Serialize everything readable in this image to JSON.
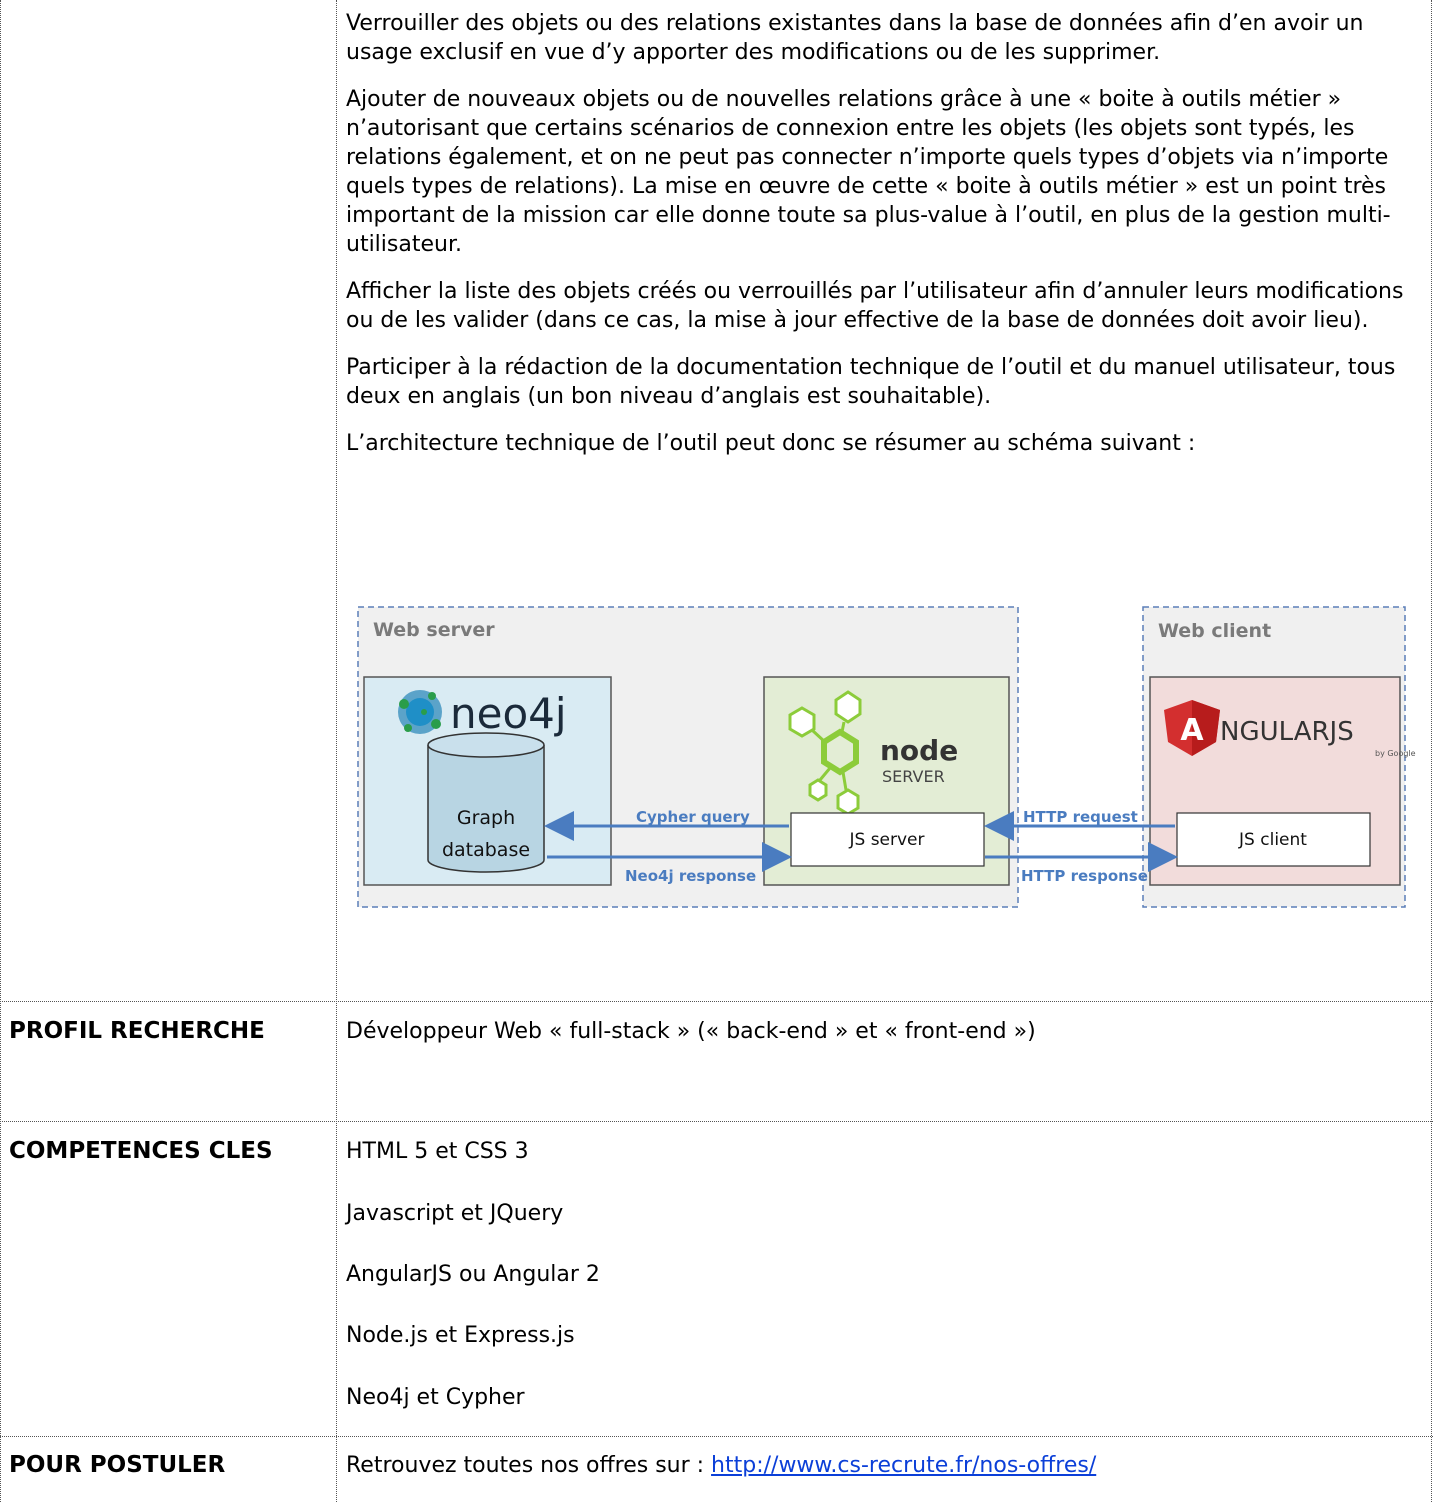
{
  "description": {
    "paragraphs": [
      "Verrouiller des objets ou des relations existantes dans la base de données afin d’en avoir un usage exclusif en vue d’y apporter des modifications ou de les supprimer.",
      "Ajouter de nouveaux objets ou de nouvelles relations grâce à une « boite à outils métier » n’autorisant que certains scénarios de connexion entre les objets (les objets sont typés, les relations également, et on ne peut pas connecter n’importe quels types d’objets via n’importe quels types de relations). La mise en œuvre de cette « boite à outils métier » est un point très important de la mission car elle donne toute sa plus-value à l’outil, en plus de la gestion multi-utilisateur.",
      "Afficher la liste des objets créés ou verrouillés par l’utilisateur afin d’annuler leurs modifications ou de les valider (dans ce cas, la mise à jour effective de la base de données doit avoir lieu).",
      "Participer à la rédaction de la documentation technique de l’outil et du manuel utilisateur, tous deux en anglais (un bon niveau d’anglais est souhaitable).",
      "L’architecture technique de l’outil peut donc se résumer au schéma suivant :"
    ]
  },
  "diagram": {
    "web_server_label": "Web server",
    "web_client_label": "Web client",
    "neo4j_logo": "neo4j",
    "graph_db_line1": "Graph",
    "graph_db_line2": "database",
    "node_logo_main": "node",
    "node_logo_sub": "SERVER",
    "angular_logo_a": "A",
    "angular_logo_rest": "NGULARJS",
    "angular_logo_by": "by Google",
    "js_server": "JS server",
    "js_client": "JS client",
    "cypher_query": "Cypher query",
    "neo4j_response": "Neo4j response",
    "http_request": "HTTP  request",
    "http_response": "HTTP  response"
  },
  "profile": {
    "label": "PROFIL RECHERCHE",
    "value": "Développeur Web « full-stack » (« back-end » et « front-end »)"
  },
  "skills": {
    "label": "COMPETENCES CLES",
    "items": [
      "HTML 5 et CSS 3",
      "Javascript et JQuery",
      "AngularJS ou Angular 2",
      "Node.js et Express.js",
      "Neo4j et Cypher"
    ]
  },
  "apply": {
    "label": "POUR POSTULER",
    "text": "Retrouvez toutes nos offres sur : ",
    "link": "http://www.cs-recrute.fr/nos-offres/"
  }
}
